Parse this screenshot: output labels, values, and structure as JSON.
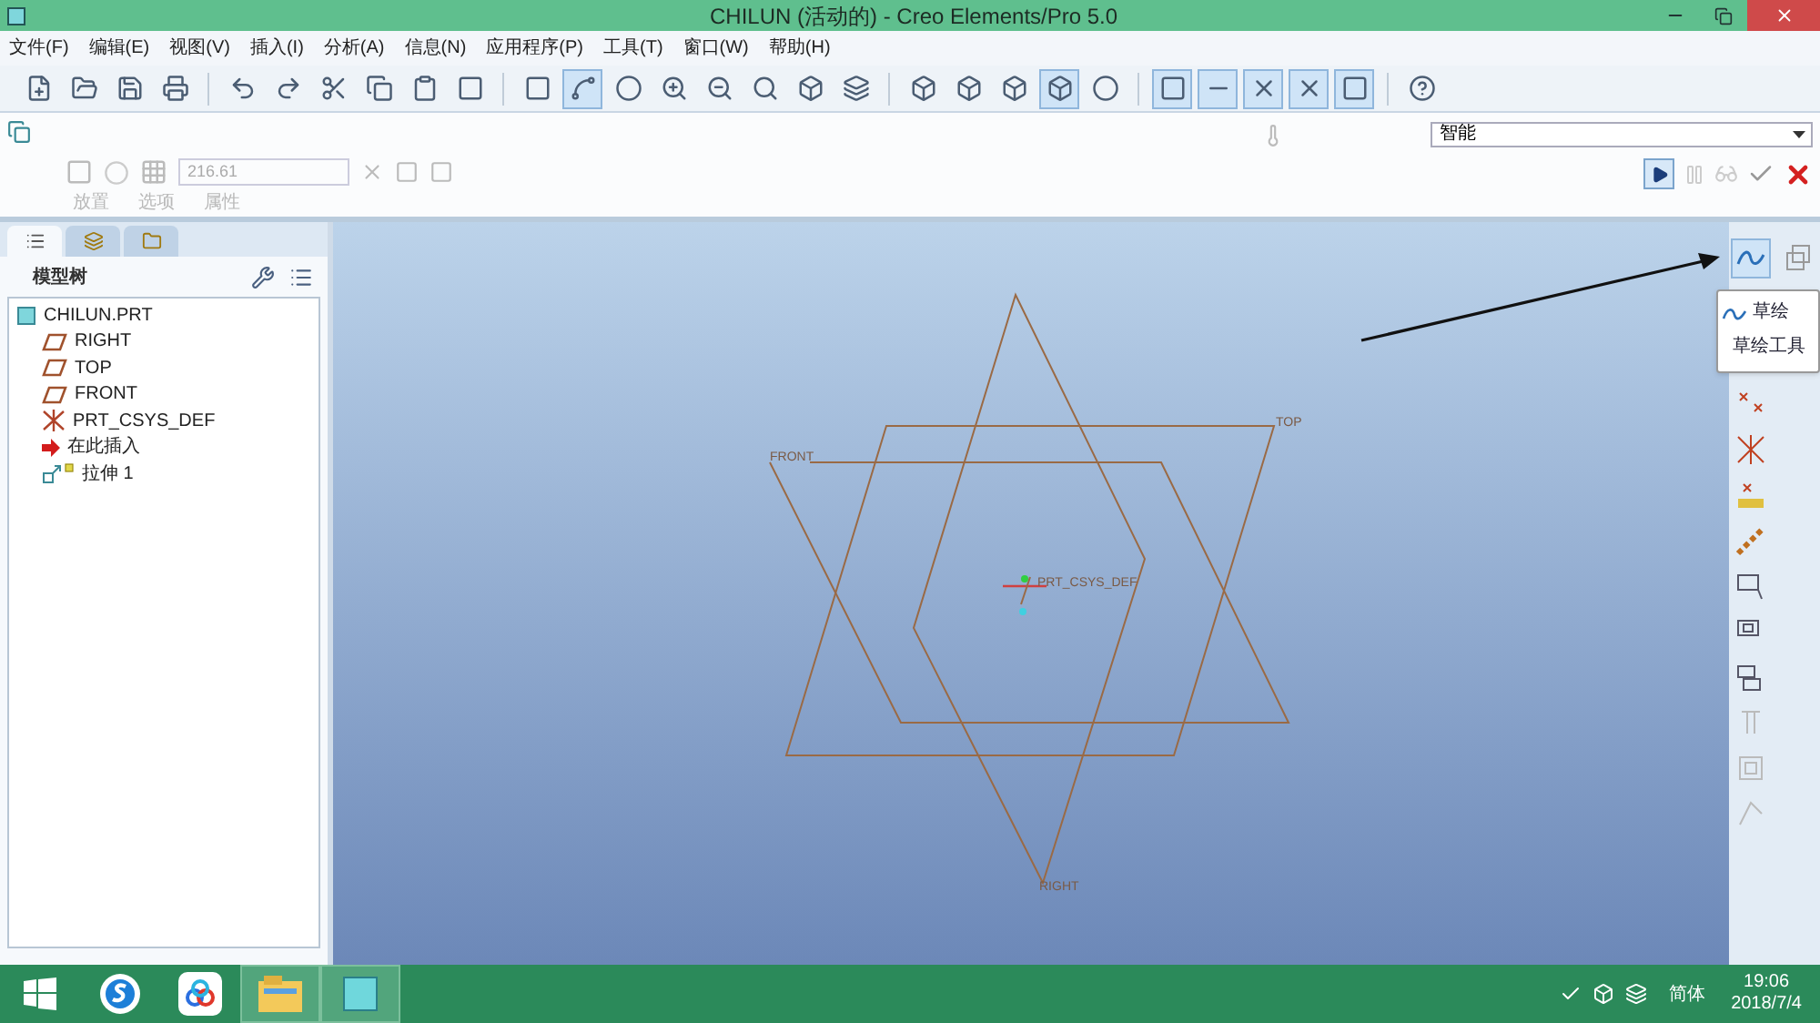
{
  "window": {
    "title": "CHILUN (活动的) - Creo Elements/Pro 5.0"
  },
  "menu": [
    "文件(F)",
    "编辑(E)",
    "视图(V)",
    "插入(I)",
    "分析(A)",
    "信息(N)",
    "应用程序(P)",
    "工具(T)",
    "窗口(W)",
    "帮助(H)"
  ],
  "dashboard": {
    "value": "216.61",
    "mode_select": "智能",
    "tabs": [
      {
        "label": "放置",
        "disabled": true
      },
      {
        "label": "选项",
        "disabled": true
      },
      {
        "label": "属性",
        "disabled": true
      }
    ]
  },
  "model_tree": {
    "title": "模型树",
    "tabs": [
      {
        "selected": true
      },
      {
        "selected": false
      },
      {
        "selected": false
      }
    ],
    "items": [
      {
        "label": "CHILUN.PRT",
        "kind": "part",
        "children": [
          {
            "label": "RIGHT",
            "kind": "plane"
          },
          {
            "label": "TOP",
            "kind": "plane"
          },
          {
            "label": "FRONT",
            "kind": "plane"
          },
          {
            "label": "PRT_CSYS_DEF",
            "kind": "csys"
          },
          {
            "label": "在此插入",
            "kind": "insert"
          },
          {
            "label": "拉伸 1",
            "kind": "feature"
          }
        ]
      }
    ]
  },
  "canvas": {
    "front_label": "FRONT",
    "top_label": "TOP",
    "csys_label": "PRT_CSYS_DEF",
    "right_label": "RIGHT"
  },
  "tooltip": {
    "title": "草绘",
    "subtitle": "草绘工具"
  },
  "taskbar": {
    "apps": [
      {
        "selected": false
      },
      {
        "selected": false
      },
      {
        "selected": false
      },
      {
        "selected": true
      },
      {
        "selected": true
      }
    ],
    "ime": "简体",
    "time": "19:06",
    "date": "2018/7/4"
  }
}
